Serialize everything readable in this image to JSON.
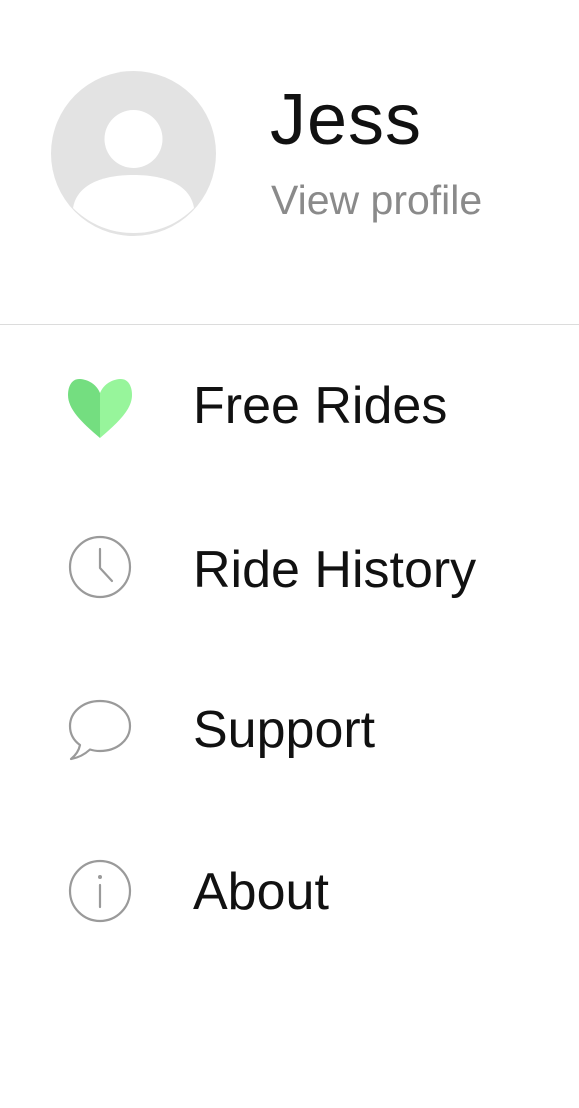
{
  "profile": {
    "name": "Jess",
    "link_label": "View profile"
  },
  "menu": {
    "items": [
      {
        "label": "Free Rides",
        "icon": "heart-icon",
        "accent": "#7ee08a"
      },
      {
        "label": "Ride History",
        "icon": "clock-icon"
      },
      {
        "label": "Support",
        "icon": "chat-bubble-icon"
      },
      {
        "label": "About",
        "icon": "info-icon"
      }
    ]
  },
  "colors": {
    "text": "#111111",
    "secondary_text": "#8a8a8a",
    "icon_stroke": "#9a9a9a",
    "avatar_bg": "#e3e3e3",
    "heart_light": "#97f59b",
    "heart_dark": "#74de80",
    "divider": "#dcdcdc"
  }
}
